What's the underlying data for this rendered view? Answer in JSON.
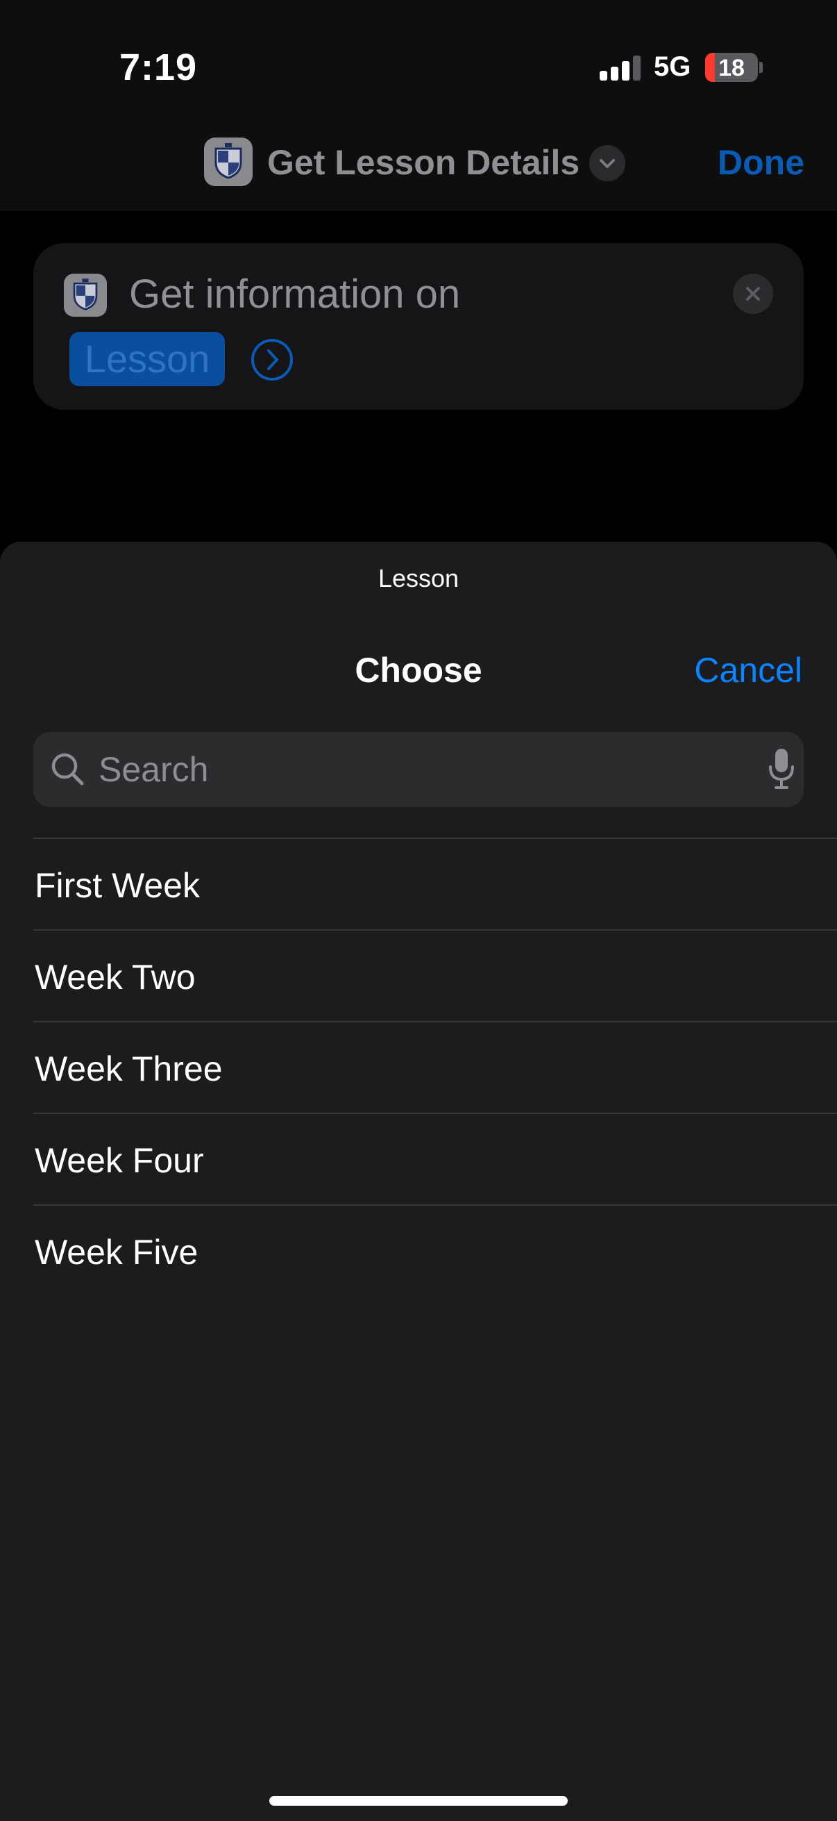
{
  "status_bar": {
    "time": "7:19",
    "network": "5G",
    "battery_level": "18",
    "battery_fraction": 0.18,
    "signal_bars_active": 3,
    "signal_bars_total": 4
  },
  "nav": {
    "title": "Get Lesson Details",
    "done_label": "Done",
    "app_icon": "university-shield-icon",
    "chevron_icon": "chevron-down-icon"
  },
  "action_card": {
    "text": "Get information on",
    "token_label": "Lesson",
    "close_icon": "close-icon",
    "arrow_icon": "chevron-right-circle-icon"
  },
  "sheet": {
    "subtitle": "Lesson",
    "title": "Choose",
    "cancel_label": "Cancel",
    "search": {
      "placeholder": "Search",
      "value": ""
    },
    "items": [
      {
        "label": "First Week"
      },
      {
        "label": "Week Two"
      },
      {
        "label": "Week Three"
      },
      {
        "label": "Week Four"
      },
      {
        "label": "Week Five"
      }
    ]
  },
  "colors": {
    "accent": "#0a84ff",
    "dimmed_accent": "#0a5bb5",
    "sheet_background": "#1c1c1e",
    "battery_low": "#ff3b30"
  }
}
